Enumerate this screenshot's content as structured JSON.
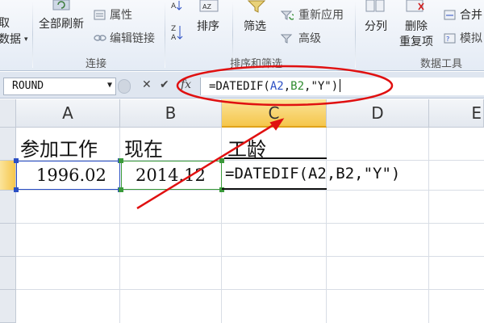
{
  "ribbon": {
    "left_fragments": [
      "取",
      "数据"
    ],
    "refresh_all": "全部刷新",
    "properties": "属性",
    "edit_links": "编辑链接",
    "connections_group": "连接",
    "sort": "排序",
    "filter": "筛选",
    "reapply": "重新应用",
    "advanced": "高级",
    "sort_filter_group": "排序和筛选",
    "split_column": "分列",
    "remove_dup_line1": "删除",
    "remove_dup_line2": "重复项",
    "merge_calc": "合并",
    "simulate": "模拟",
    "data_tools_group": "数据工具"
  },
  "formula_bar": {
    "name_box": "ROUND",
    "formula_prefix": "=DATEDIF(",
    "ref_a": "A2",
    "comma1": ",",
    "ref_b": "B2",
    "formula_suffix": ",\"Y\")",
    "fx_label": "fx"
  },
  "sheet": {
    "columns": [
      "A",
      "B",
      "C",
      "D",
      "E"
    ],
    "rows": [
      {
        "a": "参加工作",
        "b": "现在",
        "c": "工龄",
        "d": ""
      },
      {
        "a": "1996.02",
        "b": "2014.12",
        "c": "=DATEDIF(A2,B2,\"Y\")",
        "d": ""
      }
    ],
    "active_column": "C"
  },
  "colors": {
    "ref_a": "#2b4fc4",
    "ref_b": "#2e8b2e",
    "annotation": "#e01010",
    "active_header": "#f5c64b"
  }
}
